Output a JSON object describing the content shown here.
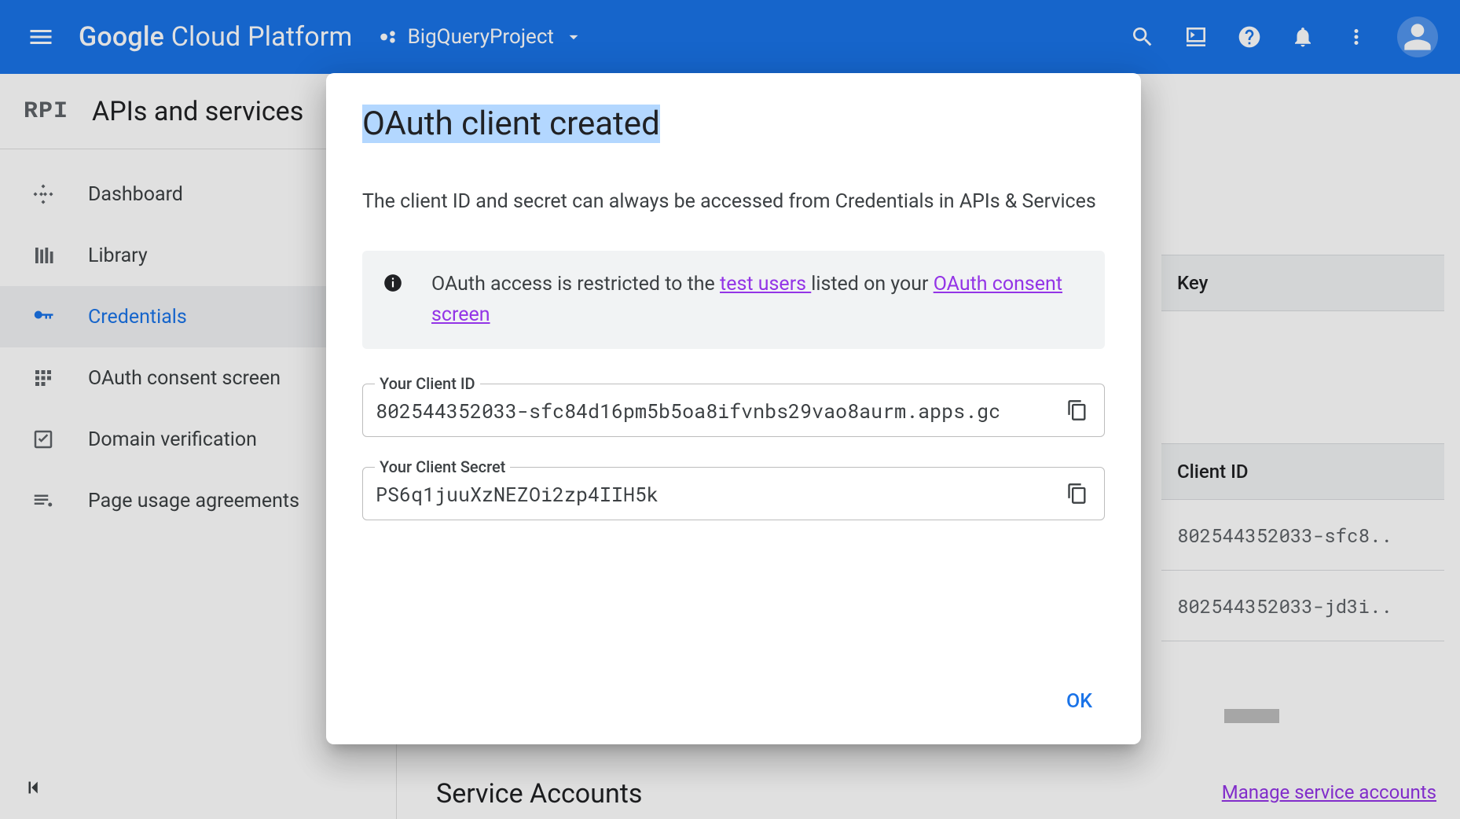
{
  "header": {
    "logo_strong": "Google",
    "logo_rest": " Cloud Platform",
    "project_name": "BigQueryProject"
  },
  "sidebar": {
    "section_logo": "RPI",
    "section_title": "APIs and services",
    "items": [
      {
        "label": "Dashboard"
      },
      {
        "label": "Library"
      },
      {
        "label": "Credentials"
      },
      {
        "label": "OAuth consent screen"
      },
      {
        "label": "Domain verification"
      },
      {
        "label": "Page usage agreements"
      }
    ]
  },
  "modal": {
    "title": "OAuth client created",
    "description": "The client ID and secret can always be accessed from Credentials in APIs & Services",
    "info_pre": "OAuth access is restricted to the ",
    "info_link1": "test users ",
    "info_mid": "listed on your ",
    "info_link2": "OAuth consent screen",
    "client_id_label": "Your Client ID",
    "client_id_value": "802544352033-sfc84d16pm5b5oa8ifvnbs29vao8aurm.apps.gc",
    "client_secret_label": "Your Client Secret",
    "client_secret_value": "PS6q1juuXzNEZOi2zp4IIH5k",
    "ok_label": "OK"
  },
  "bg_table": {
    "col_key": "Key",
    "col_clientid": "Client ID",
    "row1": "802544352033-sfc8..",
    "row2": "802544352033-jd3i.."
  },
  "bg_section": {
    "service_accounts": "Service Accounts",
    "manage_link": "Manage service accounts"
  }
}
